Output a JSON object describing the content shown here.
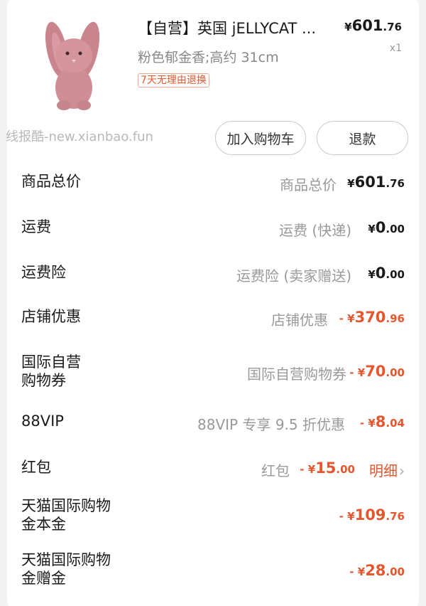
{
  "product": {
    "title": "【自营】英国 jELLYCAT ...",
    "price_symbol": "¥",
    "price_int": "601",
    "price_dec": ".76",
    "quantity": "x1",
    "spec": "粉色郁金香;高约 31cm",
    "tag": "7天无理由退换"
  },
  "watermark": "线报酷-new.xianbao.fun",
  "buttons": {
    "add_cart": "加入购物车",
    "refund": "退款"
  },
  "rows": [
    {
      "label": "商品总价",
      "sub": "商品总价",
      "prefix": "",
      "symbol": "¥",
      "int": "601",
      "dec": ".76",
      "style": "black"
    },
    {
      "label": "运费",
      "sub": "运费 (快递)",
      "prefix": "",
      "symbol": "¥",
      "int": "0",
      "dec": ".00",
      "style": "black"
    },
    {
      "label": "运费险",
      "sub": "运费险 (卖家赠送)",
      "prefix": "",
      "symbol": "¥",
      "int": "0",
      "dec": ".00",
      "style": "black"
    },
    {
      "label": "店铺优惠",
      "sub": "店铺优惠",
      "prefix": "- ",
      "symbol": "¥",
      "int": "370",
      "dec": ".96",
      "style": "orange"
    },
    {
      "label": "国际自营\n购物券",
      "sub": "国际自营购物券",
      "prefix": "- ",
      "symbol": "¥",
      "int": "70",
      "dec": ".00",
      "style": "orange"
    },
    {
      "label": "88VIP",
      "sub": "88VIP 专享 9.5 折优惠",
      "prefix": "- ",
      "symbol": "¥",
      "int": "8",
      "dec": ".04",
      "style": "orange"
    },
    {
      "label": "红包",
      "sub": "红包",
      "prefix": "- ",
      "symbol": "¥",
      "int": "15",
      "dec": ".00",
      "style": "orange",
      "detail": "明细"
    },
    {
      "label": "天猫国际购物\n金本金",
      "sub": "",
      "prefix": "- ",
      "symbol": "¥",
      "int": "109",
      "dec": ".76",
      "style": "orange"
    },
    {
      "label": "天猫国际购物\n金赠金",
      "sub": "",
      "prefix": "- ",
      "symbol": "¥",
      "int": "28",
      "dec": ".00",
      "style": "orange"
    }
  ],
  "colors": {
    "accent": "#e4572e",
    "muted": "#999999",
    "background": "#f2f2f2"
  },
  "icons": {
    "product_image": "pink-bunny-plush",
    "detail_chevron": "chevron-right-icon"
  }
}
